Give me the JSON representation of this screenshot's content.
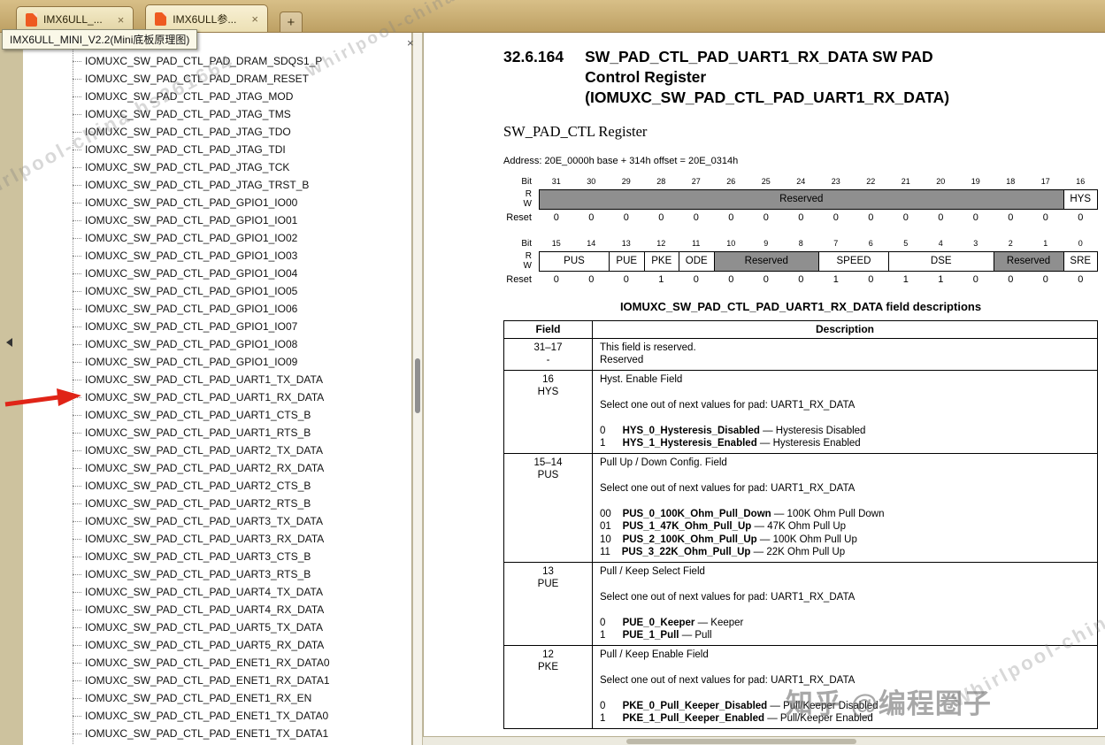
{
  "tab_bar": {
    "tabs": [
      {
        "label": "IMX6ULL_...",
        "close": "×"
      },
      {
        "label": "IMX6ULL参...",
        "close": "×"
      }
    ],
    "new_tab": "+",
    "tooltip": "IMX6ULL_MINI_V2.2(Mini底板原理图)"
  },
  "sidebar": {
    "close": "×",
    "arrow_target_index": 19,
    "items": [
      "IOMUXC_SW_PAD_CTL_PAD_DRAM_SDQS1_P",
      "IOMUXC_SW_PAD_CTL_PAD_DRAM_RESET",
      "IOMUXC_SW_PAD_CTL_PAD_JTAG_MOD",
      "IOMUXC_SW_PAD_CTL_PAD_JTAG_TMS",
      "IOMUXC_SW_PAD_CTL_PAD_JTAG_TDO",
      "IOMUXC_SW_PAD_CTL_PAD_JTAG_TDI",
      "IOMUXC_SW_PAD_CTL_PAD_JTAG_TCK",
      "IOMUXC_SW_PAD_CTL_PAD_JTAG_TRST_B",
      "IOMUXC_SW_PAD_CTL_PAD_GPIO1_IO00",
      "IOMUXC_SW_PAD_CTL_PAD_GPIO1_IO01",
      "IOMUXC_SW_PAD_CTL_PAD_GPIO1_IO02",
      "IOMUXC_SW_PAD_CTL_PAD_GPIO1_IO03",
      "IOMUXC_SW_PAD_CTL_PAD_GPIO1_IO04",
      "IOMUXC_SW_PAD_CTL_PAD_GPIO1_IO05",
      "IOMUXC_SW_PAD_CTL_PAD_GPIO1_IO06",
      "IOMUXC_SW_PAD_CTL_PAD_GPIO1_IO07",
      "IOMUXC_SW_PAD_CTL_PAD_GPIO1_IO08",
      "IOMUXC_SW_PAD_CTL_PAD_GPIO1_IO09",
      "IOMUXC_SW_PAD_CTL_PAD_UART1_TX_DATA",
      "IOMUXC_SW_PAD_CTL_PAD_UART1_RX_DATA",
      "IOMUXC_SW_PAD_CTL_PAD_UART1_CTS_B",
      "IOMUXC_SW_PAD_CTL_PAD_UART1_RTS_B",
      "IOMUXC_SW_PAD_CTL_PAD_UART2_TX_DATA",
      "IOMUXC_SW_PAD_CTL_PAD_UART2_RX_DATA",
      "IOMUXC_SW_PAD_CTL_PAD_UART2_CTS_B",
      "IOMUXC_SW_PAD_CTL_PAD_UART2_RTS_B",
      "IOMUXC_SW_PAD_CTL_PAD_UART3_TX_DATA",
      "IOMUXC_SW_PAD_CTL_PAD_UART3_RX_DATA",
      "IOMUXC_SW_PAD_CTL_PAD_UART3_CTS_B",
      "IOMUXC_SW_PAD_CTL_PAD_UART3_RTS_B",
      "IOMUXC_SW_PAD_CTL_PAD_UART4_TX_DATA",
      "IOMUXC_SW_PAD_CTL_PAD_UART4_RX_DATA",
      "IOMUXC_SW_PAD_CTL_PAD_UART5_TX_DATA",
      "IOMUXC_SW_PAD_CTL_PAD_UART5_RX_DATA",
      "IOMUXC_SW_PAD_CTL_PAD_ENET1_RX_DATA0",
      "IOMUXC_SW_PAD_CTL_PAD_ENET1_RX_DATA1",
      "IOMUXC_SW_PAD_CTL_PAD_ENET1_RX_EN",
      "IOMUXC_SW_PAD_CTL_PAD_ENET1_TX_DATA0",
      "IOMUXC_SW_PAD_CTL_PAD_ENET1_TX_DATA1"
    ]
  },
  "document": {
    "section_number": "32.6.164",
    "title_lines": [
      "SW_PAD_CTL_PAD_UART1_RX_DATA SW PAD",
      "Control Register",
      "(IOMUXC_SW_PAD_CTL_PAD_UART1_RX_DATA)"
    ],
    "subtitle": "SW_PAD_CTL Register",
    "address": "Address: 20E_0000h base + 314h offset = 20E_0314h",
    "registers": [
      {
        "bit_label": "Bit",
        "r_label": "R",
        "w_label": "W",
        "reset_label": "Reset",
        "bits": [
          "31",
          "30",
          "29",
          "28",
          "27",
          "26",
          "25",
          "24",
          "23",
          "22",
          "21",
          "20",
          "19",
          "18",
          "17",
          "16"
        ],
        "fields": [
          {
            "name": "Reserved",
            "span": 15,
            "reserved": true
          },
          {
            "name": "HYS",
            "span": 1,
            "reserved": false
          }
        ],
        "reset": [
          "0",
          "0",
          "0",
          "0",
          "0",
          "0",
          "0",
          "0",
          "0",
          "0",
          "0",
          "0",
          "0",
          "0",
          "0",
          "0"
        ]
      },
      {
        "bit_label": "Bit",
        "r_label": "R",
        "w_label": "W",
        "reset_label": "Reset",
        "bits": [
          "15",
          "14",
          "13",
          "12",
          "11",
          "10",
          "9",
          "8",
          "7",
          "6",
          "5",
          "4",
          "3",
          "2",
          "1",
          "0"
        ],
        "fields": [
          {
            "name": "PUS",
            "span": 2,
            "reserved": false
          },
          {
            "name": "PUE",
            "span": 1,
            "reserved": false
          },
          {
            "name": "PKE",
            "span": 1,
            "reserved": false
          },
          {
            "name": "ODE",
            "span": 1,
            "reserved": false
          },
          {
            "name": "Reserved",
            "span": 3,
            "reserved": true
          },
          {
            "name": "SPEED",
            "span": 2,
            "reserved": false
          },
          {
            "name": "DSE",
            "span": 3,
            "reserved": false
          },
          {
            "name": "Reserved",
            "span": 2,
            "reserved": true
          },
          {
            "name": "SRE",
            "span": 1,
            "reserved": false
          }
        ],
        "reset": [
          "0",
          "0",
          "0",
          "1",
          "0",
          "0",
          "0",
          "0",
          "1",
          "0",
          "1",
          "1",
          "0",
          "0",
          "0",
          "0"
        ]
      }
    ],
    "field_table": {
      "title": "IOMUXC_SW_PAD_CTL_PAD_UART1_RX_DATA field descriptions",
      "col_field": "Field",
      "col_desc": "Description",
      "rows": [
        {
          "field": [
            "31–17",
            "-"
          ],
          "desc": [
            [
              {
                "t": "This field is reserved."
              }
            ],
            [
              {
                "t": "Reserved"
              }
            ]
          ]
        },
        {
          "field": [
            "16",
            "HYS"
          ],
          "desc": [
            [
              {
                "t": "Hyst. Enable Field"
              }
            ],
            [],
            [
              {
                "t": "Select one out of next values for pad: UART1_RX_DATA"
              }
            ],
            [],
            [
              {
                "t": "0      "
              },
              {
                "t": "HYS_0_Hysteresis_Disabled",
                "b": true
              },
              {
                "t": " — Hysteresis Disabled"
              }
            ],
            [
              {
                "t": "1      "
              },
              {
                "t": "HYS_1_Hysteresis_Enabled",
                "b": true
              },
              {
                "t": " — Hysteresis Enabled"
              }
            ]
          ]
        },
        {
          "field": [
            "15–14",
            "PUS"
          ],
          "desc": [
            [
              {
                "t": "Pull Up / Down Config. Field"
              }
            ],
            [],
            [
              {
                "t": "Select one out of next values for pad: UART1_RX_DATA"
              }
            ],
            [],
            [
              {
                "t": "00    "
              },
              {
                "t": "PUS_0_100K_Ohm_Pull_Down",
                "b": true
              },
              {
                "t": " — 100K Ohm Pull Down"
              }
            ],
            [
              {
                "t": "01    "
              },
              {
                "t": "PUS_1_47K_Ohm_Pull_Up",
                "b": true
              },
              {
                "t": " — 47K Ohm Pull Up"
              }
            ],
            [
              {
                "t": "10    "
              },
              {
                "t": "PUS_2_100K_Ohm_Pull_Up",
                "b": true
              },
              {
                "t": " — 100K Ohm Pull Up"
              }
            ],
            [
              {
                "t": "11    "
              },
              {
                "t": "PUS_3_22K_Ohm_Pull_Up",
                "b": true
              },
              {
                "t": " — 22K Ohm Pull Up"
              }
            ]
          ]
        },
        {
          "field": [
            "13",
            "PUE"
          ],
          "desc": [
            [
              {
                "t": "Pull / Keep Select Field"
              }
            ],
            [],
            [
              {
                "t": "Select one out of next values for pad: UART1_RX_DATA"
              }
            ],
            [],
            [
              {
                "t": "0      "
              },
              {
                "t": "PUE_0_Keeper",
                "b": true
              },
              {
                "t": " — Keeper"
              }
            ],
            [
              {
                "t": "1      "
              },
              {
                "t": "PUE_1_Pull",
                "b": true
              },
              {
                "t": " — Pull"
              }
            ]
          ]
        },
        {
          "field": [
            "12",
            "PKE"
          ],
          "desc": [
            [
              {
                "t": "Pull / Keep Enable Field"
              }
            ],
            [],
            [
              {
                "t": "Select one out of next values for pad: UART1_RX_DATA"
              }
            ],
            [],
            [
              {
                "t": "0      "
              },
              {
                "t": "PKE_0_Pull_Keeper_Disabled",
                "b": true
              },
              {
                "t": " — Pull/Keeper Disabled"
              }
            ],
            [
              {
                "t": "1      "
              },
              {
                "t": "PKE_1_Pull_Keeper_Enabled",
                "b": true
              },
              {
                "t": " — Pull/Keeper Enabled"
              }
            ]
          ]
        }
      ]
    }
  },
  "watermarks": {
    "diagonal": "Whirlpool-china hs261664",
    "zhihu": "知乎 @编程圈子"
  }
}
